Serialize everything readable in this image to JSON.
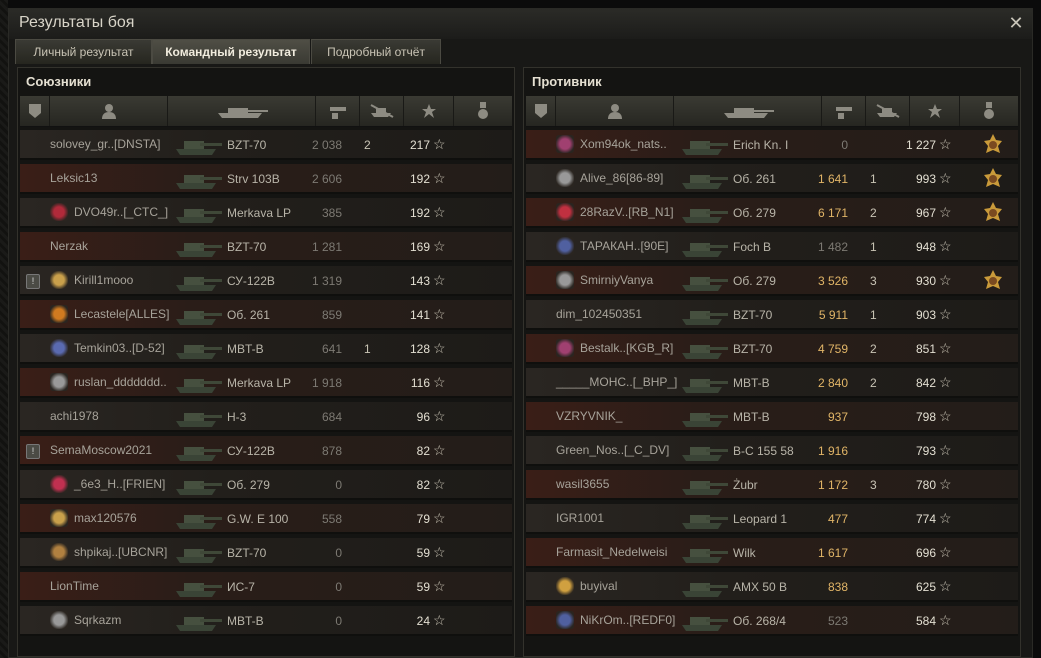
{
  "window": {
    "title": "Результаты боя",
    "close_icon": "✕"
  },
  "tabs": [
    {
      "label": "Личный результат",
      "active": false
    },
    {
      "label": "Командный результат",
      "active": true
    },
    {
      "label": "Подробный отчёт",
      "active": false
    }
  ],
  "allies": {
    "title": "Союзники",
    "rows": [
      {
        "name": "solovey_gr..[DNSTA]",
        "tank": "BZT-70",
        "damage": "2 038",
        "kills": "2",
        "xp": "217",
        "clan": false,
        "platoon": false,
        "highlight": false,
        "alt": false
      },
      {
        "name": "Leksic13",
        "tank": "Strv 103B",
        "damage": "2 606",
        "kills": "",
        "xp": "192",
        "clan": false,
        "platoon": false,
        "highlight": false,
        "alt": true
      },
      {
        "name": "DVO49r..[_CTC_]",
        "tank": "Merkava LP",
        "damage": "385",
        "kills": "",
        "xp": "192",
        "clan": true,
        "clan_color": "#b02a3a",
        "platoon": false,
        "alt": false
      },
      {
        "name": "Nerzak",
        "tank": "BZT-70",
        "damage": "1 281",
        "kills": "",
        "xp": "169",
        "clan": false,
        "platoon": false,
        "alt": true
      },
      {
        "name": "Kirill1mooo",
        "tank": "СУ-122В",
        "damage": "1 319",
        "kills": "",
        "xp": "143",
        "clan": true,
        "clan_color": "#c9a04b",
        "platoon": true,
        "alt": false
      },
      {
        "name": "Lecastele[ALLES]",
        "tank": "Об. 261",
        "damage": "859",
        "kills": "",
        "xp": "141",
        "clan": true,
        "clan_color": "#d07a20",
        "platoon": false,
        "alt": true
      },
      {
        "name": "Temkin03..[D-52]",
        "tank": "MBT-B",
        "damage": "641",
        "kills": "1",
        "xp": "128",
        "clan": true,
        "clan_color": "#5a6ab0",
        "platoon": false,
        "alt": false
      },
      {
        "name": "ruslan_ddddddd..",
        "tank": "Merkava LP",
        "damage": "1 918",
        "kills": "",
        "xp": "116",
        "clan": true,
        "clan_color": "#999999",
        "platoon": false,
        "alt": true
      },
      {
        "name": "achi1978",
        "tank": "Н-3",
        "damage": "684",
        "kills": "",
        "xp": "96",
        "clan": false,
        "platoon": false,
        "alt": false
      },
      {
        "name": "SemaMoscow2021",
        "tank": "СУ-122В",
        "damage": "878",
        "kills": "",
        "xp": "82",
        "clan": false,
        "platoon": true,
        "alt": true
      },
      {
        "name": "_6e3_H..[FRIEN]",
        "tank": "Об. 279",
        "damage": "0",
        "kills": "",
        "xp": "82",
        "clan": true,
        "clan_color": "#c03050",
        "platoon": false,
        "alt": false
      },
      {
        "name": "max120576",
        "tank": "G.W. E 100",
        "damage": "558",
        "kills": "",
        "xp": "79",
        "clan": true,
        "clan_color": "#c9a04b",
        "platoon": false,
        "alt": true
      },
      {
        "name": "shpikaj..[UBCNR]",
        "tank": "BZT-70",
        "damage": "0",
        "kills": "",
        "xp": "59",
        "clan": true,
        "clan_color": "#b08040",
        "platoon": false,
        "alt": false
      },
      {
        "name": "LionTime",
        "tank": "ИС-7",
        "damage": "0",
        "kills": "",
        "xp": "59",
        "clan": false,
        "platoon": false,
        "alt": true
      },
      {
        "name": "Sqrkazm",
        "tank": "MBT-B",
        "damage": "0",
        "kills": "",
        "xp": "24",
        "clan": true,
        "clan_color": "#999999",
        "platoon": false,
        "alt": false
      }
    ]
  },
  "enemies": {
    "title": "Противник",
    "rows": [
      {
        "name": "Xom94ok_nats..",
        "tank": "Erich Kn. I",
        "damage": "0",
        "dmg_hi": false,
        "kills": "",
        "xp": "1 227",
        "clan": true,
        "clan_color": "#a04070",
        "medal": true,
        "alt": true
      },
      {
        "name": "Alive_86[86-89]",
        "tank": "Об. 261",
        "damage": "1 641",
        "dmg_hi": true,
        "kills": "1",
        "xp": "993",
        "clan": true,
        "clan_color": "#999999",
        "medal": true,
        "alt": false
      },
      {
        "name": "28RazV..[RB_N1]",
        "tank": "Об. 279",
        "damage": "6 171",
        "dmg_hi": true,
        "kills": "2",
        "xp": "967",
        "clan": true,
        "clan_color": "#c03040",
        "medal": true,
        "alt": true
      },
      {
        "name": "ТАРАКАН..[90E]",
        "tank": "Foch B",
        "damage": "1 482",
        "dmg_hi": false,
        "kills": "1",
        "xp": "948",
        "clan": true,
        "clan_color": "#5060a0",
        "medal": false,
        "alt": false
      },
      {
        "name": "SmirniyVanya",
        "tank": "Об. 279",
        "damage": "3 526",
        "dmg_hi": true,
        "kills": "3",
        "xp": "930",
        "clan": true,
        "clan_color": "#999999",
        "medal": true,
        "alt": true
      },
      {
        "name": "dim_102450351",
        "tank": "BZT-70",
        "damage": "5 911",
        "dmg_hi": true,
        "kills": "1",
        "xp": "903",
        "clan": false,
        "medal": false,
        "alt": false
      },
      {
        "name": "Bestalk..[KGB_R]",
        "tank": "BZT-70",
        "damage": "4 759",
        "dmg_hi": true,
        "kills": "2",
        "xp": "851",
        "clan": true,
        "clan_color": "#a04070",
        "medal": false,
        "alt": true
      },
      {
        "name": "_____MOHC..[_BHP_]",
        "tank": "MBT-B",
        "damage": "2 840",
        "dmg_hi": true,
        "kills": "2",
        "xp": "842",
        "clan": false,
        "medal": false,
        "alt": false
      },
      {
        "name": "VZRYVNIK_",
        "tank": "MBT-B",
        "damage": "937",
        "dmg_hi": true,
        "kills": "",
        "xp": "798",
        "clan": false,
        "medal": false,
        "alt": true
      },
      {
        "name": "Green_Nos..[_C_DV]",
        "tank": "В-С 155 58",
        "damage": "1 916",
        "dmg_hi": true,
        "kills": "",
        "xp": "793",
        "clan": false,
        "medal": false,
        "alt": false
      },
      {
        "name": "wasil3655",
        "tank": "Żubr",
        "damage": "1 172",
        "dmg_hi": true,
        "kills": "3",
        "xp": "780",
        "clan": false,
        "medal": false,
        "alt": true
      },
      {
        "name": "IGR1001",
        "tank": "Leopard 1",
        "damage": "477",
        "dmg_hi": true,
        "kills": "",
        "xp": "774",
        "clan": false,
        "medal": false,
        "alt": false
      },
      {
        "name": "Farmasit_Nedelweisi",
        "tank": "Wilk",
        "damage": "1 617",
        "dmg_hi": true,
        "kills": "",
        "xp": "696",
        "clan": false,
        "medal": false,
        "alt": true
      },
      {
        "name": "buyival",
        "tank": "AMX 50 B",
        "damage": "838",
        "dmg_hi": true,
        "kills": "",
        "xp": "625",
        "clan": true,
        "clan_color": "#d0a040",
        "medal": false,
        "alt": false
      },
      {
        "name": "NiKrOm..[REDF0]",
        "tank": "Об. 268/4",
        "damage": "523",
        "dmg_hi": false,
        "kills": "",
        "xp": "584",
        "clan": true,
        "clan_color": "#5060a0",
        "medal": false,
        "alt": true
      }
    ]
  }
}
